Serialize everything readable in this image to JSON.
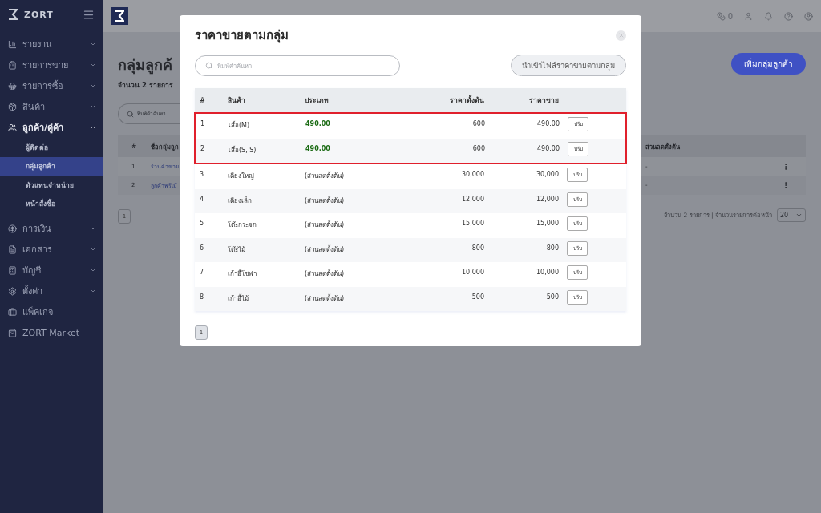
{
  "sidebar": {
    "brand": "ZORT",
    "items": [
      {
        "label": "รายงาน",
        "expanded": false
      },
      {
        "label": "รายการขาย",
        "expanded": false
      },
      {
        "label": "รายการซื้อ",
        "expanded": false
      },
      {
        "label": "สินค้า",
        "expanded": false
      },
      {
        "label": "ลูกค้า/คู่ค้า",
        "expanded": true,
        "children": [
          {
            "label": "ผู้ติดต่อ",
            "selected": false
          },
          {
            "label": "กลุ่มลูกค้า",
            "selected": true
          },
          {
            "label": "ตัวแทนจำหน่าย",
            "selected": false
          },
          {
            "label": "หน้าสั่งซื้อ",
            "selected": false
          }
        ]
      },
      {
        "label": "การเงิน",
        "expanded": false
      },
      {
        "label": "เอกสาร",
        "expanded": false
      },
      {
        "label": "บัญชี",
        "expanded": false
      },
      {
        "label": "ตั้งค่า",
        "expanded": false
      },
      {
        "label": "แพ็คเกจ"
      },
      {
        "label": "ZORT Market"
      }
    ]
  },
  "header": {
    "coins": "0"
  },
  "page": {
    "title": "กลุ่มลูกค้",
    "count": "จำนวน 2 รายการ",
    "search_placeholder": "พิมพ์คำค้นหา",
    "add_button": "เพิ่มกลุ่มลูกค้า",
    "table": {
      "columns": [
        "#",
        "ชื่อกลุ่มลูก",
        "ส่วนลดตั้งต้น"
      ],
      "rows": [
        {
          "index": "1",
          "name": "ร้านค้าขาย",
          "discount": "-"
        },
        {
          "index": "2",
          "name": "ลูกค้าพรีเมี",
          "discount": "-"
        }
      ]
    },
    "pagination": [
      "1"
    ],
    "footer": "จำนวน 2 รายการ | จำนวนรายการต่อหน้า",
    "page_size": "20"
  },
  "modal": {
    "title": "ราคาขายตามกลุ่ม",
    "search_placeholder": "พิมพ์คำค้นหา",
    "import_button": "นำเข้าไฟล์ราคาขายตามกลุ่ม",
    "table": {
      "columns": [
        "#",
        "สินค้า",
        "ประเภท",
        "ราคาตั้งต้น",
        "ราคาขาย"
      ],
      "rows": [
        {
          "index": "1",
          "product": "เสื้อ(M)",
          "type": "490.00",
          "kind": "price",
          "base_price": "600",
          "sale_price": "490.00",
          "action": "ปรับ",
          "highlighted": true
        },
        {
          "index": "2",
          "product": "เสื้อ(S, S)",
          "type": "490.00",
          "kind": "price",
          "base_price": "600",
          "sale_price": "490.00",
          "action": "ปรับ",
          "highlighted": true
        },
        {
          "index": "3",
          "product": "เตียงใหญ่",
          "type": "(ส่วนลดตั้งต้น)",
          "kind": "discount",
          "base_price": "30,000",
          "sale_price": "30,000",
          "action": "ปรับ",
          "highlighted": false
        },
        {
          "index": "4",
          "product": "เตียงเล็ก",
          "type": "(ส่วนลดตั้งต้น)",
          "kind": "discount",
          "base_price": "12,000",
          "sale_price": "12,000",
          "action": "ปรับ",
          "highlighted": false
        },
        {
          "index": "5",
          "product": "โต๊ะกระจก",
          "type": "(ส่วนลดตั้งต้น)",
          "kind": "discount",
          "base_price": "15,000",
          "sale_price": "15,000",
          "action": "ปรับ",
          "highlighted": false
        },
        {
          "index": "6",
          "product": "โต๊ะไม้",
          "type": "(ส่วนลดตั้งต้น)",
          "kind": "discount",
          "base_price": "800",
          "sale_price": "800",
          "action": "ปรับ",
          "highlighted": false
        },
        {
          "index": "7",
          "product": "เก้าอี้โซฟา",
          "type": "(ส่วนลดตั้งต้น)",
          "kind": "discount",
          "base_price": "10,000",
          "sale_price": "10,000",
          "action": "ปรับ",
          "highlighted": false
        },
        {
          "index": "8",
          "product": "เก้าอี้ไม้",
          "type": "(ส่วนลดตั้งต้น)",
          "kind": "discount",
          "base_price": "500",
          "sale_price": "500",
          "action": "ปรับ",
          "highlighted": false
        }
      ]
    },
    "pagination": [
      "1"
    ]
  }
}
